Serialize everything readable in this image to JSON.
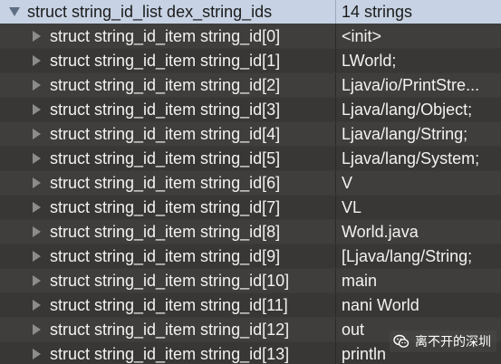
{
  "header": {
    "name": "struct string_id_list dex_string_ids",
    "value": "14 strings"
  },
  "items": [
    {
      "name": "struct string_id_item string_id[0]",
      "value": "<init>"
    },
    {
      "name": "struct string_id_item string_id[1]",
      "value": "LWorld;"
    },
    {
      "name": "struct string_id_item string_id[2]",
      "value": "Ljava/io/PrintStre..."
    },
    {
      "name": "struct string_id_item string_id[3]",
      "value": "Ljava/lang/Object;"
    },
    {
      "name": "struct string_id_item string_id[4]",
      "value": "Ljava/lang/String;"
    },
    {
      "name": "struct string_id_item string_id[5]",
      "value": "Ljava/lang/System;"
    },
    {
      "name": "struct string_id_item string_id[6]",
      "value": "V"
    },
    {
      "name": "struct string_id_item string_id[7]",
      "value": "VL"
    },
    {
      "name": "struct string_id_item string_id[8]",
      "value": "World.java"
    },
    {
      "name": "struct string_id_item string_id[9]",
      "value": "[Ljava/lang/String;"
    },
    {
      "name": "struct string_id_item string_id[10]",
      "value": "main"
    },
    {
      "name": "struct string_id_item string_id[11]",
      "value": "nani World"
    },
    {
      "name": "struct string_id_item string_id[12]",
      "value": "out"
    },
    {
      "name": "struct string_id_item string_id[13]",
      "value": "println"
    }
  ],
  "watermark": {
    "text": "离不开的深圳",
    "icon": "wechat-icon"
  },
  "colors": {
    "header_bg": "#c7d3e4",
    "row_odd": "#403e3c",
    "row_even": "#393735",
    "text": "#f2f2f2"
  }
}
